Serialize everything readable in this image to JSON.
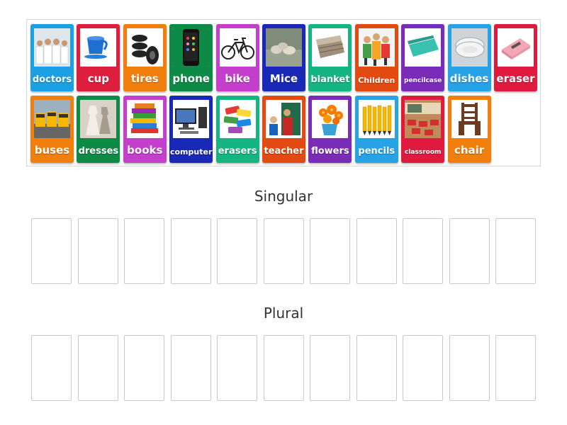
{
  "colors": {
    "blue": "#1a9be0",
    "red": "#dd1e3c",
    "orange": "#f07f0e",
    "green": "#0d8a46",
    "pink": "#c33fcc",
    "navy": "#1a28b8",
    "teal": "#14b580",
    "darkorange": "#e24a12",
    "purple": "#7a2bb8",
    "lightblue": "#27a2e6",
    "crimson": "#e0193f"
  },
  "cards": [
    {
      "label": "doctors",
      "color": "#1aa0e3",
      "icon": "doctors-photo-icon"
    },
    {
      "label": "cup",
      "color": "#dd1e3c",
      "icon": "cup-photo-icon"
    },
    {
      "label": "tires",
      "color": "#f07f0e",
      "icon": "tires-photo-icon"
    },
    {
      "label": "phone",
      "color": "#0d8a46",
      "icon": "phone-photo-icon"
    },
    {
      "label": "bike",
      "color": "#c33fcc",
      "icon": "bike-photo-icon"
    },
    {
      "label": "Mice",
      "color": "#1a28b8",
      "icon": "mice-photo-icon"
    },
    {
      "label": "blanket",
      "color": "#14b580",
      "icon": "blanket-photo-icon"
    },
    {
      "label": "Children",
      "color": "#e24a12",
      "icon": "children-photo-icon"
    },
    {
      "label": "pencilcase",
      "color": "#7a2bb8",
      "icon": "pencilcase-photo-icon"
    },
    {
      "label": "dishes",
      "color": "#27a2e6",
      "icon": "dishes-photo-icon"
    },
    {
      "label": "eraser",
      "color": "#e0193f",
      "icon": "eraser-photo-icon"
    },
    {
      "label": "buses",
      "color": "#f07f0e",
      "icon": "buses-photo-icon"
    },
    {
      "label": "dresses",
      "color": "#0d8a46",
      "icon": "dresses-photo-icon"
    },
    {
      "label": "books",
      "color": "#c33fcc",
      "icon": "books-photo-icon"
    },
    {
      "label": "computer",
      "color": "#1a28b8",
      "icon": "computer-photo-icon"
    },
    {
      "label": "erasers",
      "color": "#14b580",
      "icon": "erasers-photo-icon"
    },
    {
      "label": "teacher",
      "color": "#e24a12",
      "icon": "teacher-photo-icon"
    },
    {
      "label": "flowers",
      "color": "#7a2bb8",
      "icon": "flowers-photo-icon"
    },
    {
      "label": "pencils",
      "color": "#27a2e6",
      "icon": "pencils-photo-icon"
    },
    {
      "label": "classroom",
      "color": "#e0193f",
      "icon": "classroom-photo-icon"
    },
    {
      "label": "chair",
      "color": "#f07f0e",
      "icon": "chair-photo-icon"
    }
  ],
  "groups": [
    {
      "title": "Singular",
      "slot_count": 11
    },
    {
      "title": "Plural",
      "slot_count": 11
    }
  ]
}
